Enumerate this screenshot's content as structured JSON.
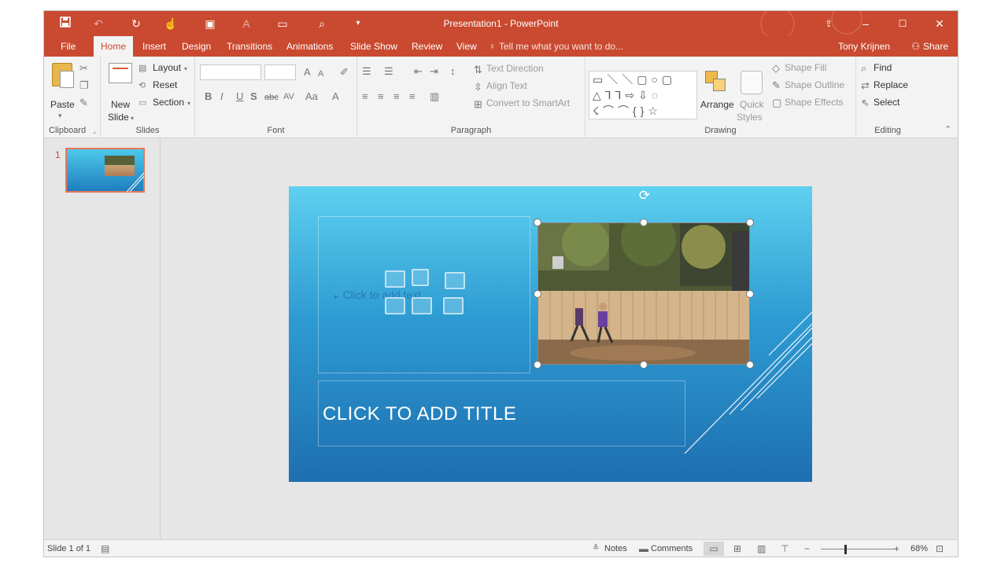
{
  "titlebar": {
    "title": "Presentation1 - PowerPoint",
    "icons": [
      "save-icon",
      "undo-icon",
      "redo-icon",
      "touch-mode-icon",
      "presenter-icon",
      "spacing-icon",
      "layout-icon",
      "print-preview-icon",
      "customize-icon"
    ],
    "window_buttons": [
      "ribbon-display-options-icon",
      "minimize-icon",
      "maximize-icon",
      "close-icon"
    ],
    "accent_color": "#c94a30"
  },
  "tabs": {
    "items": [
      {
        "label": "File"
      },
      {
        "label": "Home",
        "active": true
      },
      {
        "label": "Insert"
      },
      {
        "label": "Design"
      },
      {
        "label": "Transitions"
      },
      {
        "label": "Animations"
      },
      {
        "label": "Slide Show"
      },
      {
        "label": "Review"
      },
      {
        "label": "View"
      }
    ],
    "tell_me": "Tell me what you want to do...",
    "user": "Tony Krijnen",
    "share": "Share"
  },
  "ribbon": {
    "clipboard": {
      "paste": "Paste",
      "label": "Clipboard"
    },
    "slides": {
      "new_slide_1": "New",
      "new_slide_2": "Slide",
      "layout": "Layout",
      "reset": "Reset",
      "section": "Section",
      "label": "Slides"
    },
    "font": {
      "bold": "B",
      "italic": "I",
      "underline": "U",
      "strike": "S",
      "abc": "abc",
      "av": "AV",
      "aa": "Aa",
      "grow": "A",
      "shrink": "A",
      "color": "A",
      "label": "Font"
    },
    "paragraph": {
      "text_direction": "Text Direction",
      "align_text": "Align Text",
      "smartart": "Convert to SmartArt",
      "label": "Paragraph"
    },
    "drawing": {
      "arrange": "Arrange",
      "quick_1": "Quick",
      "quick_2": "Styles",
      "fill": "Shape Fill",
      "outline": "Shape Outline",
      "effects": "Shape Effects",
      "label": "Drawing"
    },
    "editing": {
      "find": "Find",
      "replace": "Replace",
      "select": "Select",
      "label": "Editing"
    }
  },
  "slides_pane": {
    "slide_number": "1"
  },
  "slide": {
    "content_placeholder": "Click to add text",
    "title_placeholder": "CLICK TO ADD TITLE"
  },
  "statusbar": {
    "slide_info": "Slide 1 of 1",
    "notes": "Notes",
    "comments": "Comments",
    "zoom": "68%",
    "zoom_level": 0.68
  }
}
